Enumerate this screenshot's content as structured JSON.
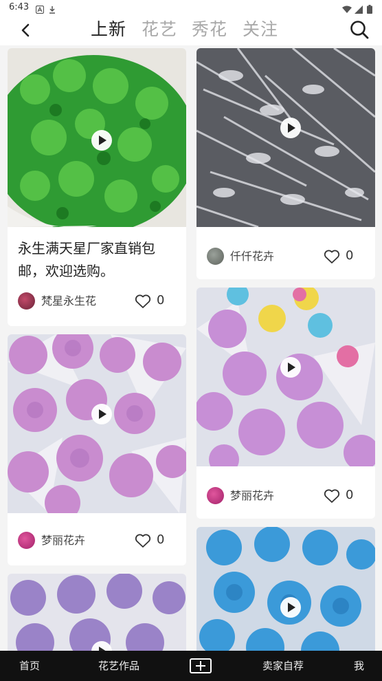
{
  "status_bar": {
    "time": "6:43",
    "icons": [
      "notification-a-icon",
      "download-icon",
      "wifi-icon",
      "signal-icon",
      "battery-icon"
    ]
  },
  "header": {
    "back_icon": "chevron-left-icon",
    "tabs": [
      {
        "label": "上新",
        "active": true
      },
      {
        "label": "花艺",
        "active": false
      },
      {
        "label": "秀花",
        "active": false
      },
      {
        "label": "关注",
        "active": false
      }
    ],
    "search_icon": "search-icon"
  },
  "feed": {
    "left": [
      {
        "title": "永生满天星厂家直销包邮，欢迎选购。",
        "author": "梵星永生花",
        "likes": "0",
        "has_video": true,
        "image_color": "#3aa838"
      },
      {
        "title": "",
        "author": "梦丽花卉",
        "likes": "0",
        "has_video": true,
        "image_color": "#c792d3"
      },
      {
        "title": "",
        "author": "",
        "likes": "",
        "has_video": true,
        "image_color": "#9b86c9"
      }
    ],
    "right": [
      {
        "title": "",
        "author": "仟仟花卉",
        "likes": "0",
        "has_video": true,
        "image_color": "#a9aab0"
      },
      {
        "title": "",
        "author": "梦丽花卉",
        "likes": "0",
        "has_video": true,
        "image_color": "#c59ad5"
      },
      {
        "title": "",
        "author": "",
        "likes": "",
        "has_video": true,
        "image_color": "#3f9fdc"
      }
    ]
  },
  "bottom_nav": {
    "items": [
      {
        "label": "首页"
      },
      {
        "label": "花艺作品"
      },
      {
        "label": "卖家自荐"
      },
      {
        "label": "我"
      }
    ],
    "add_icon": "plus-square-icon"
  }
}
